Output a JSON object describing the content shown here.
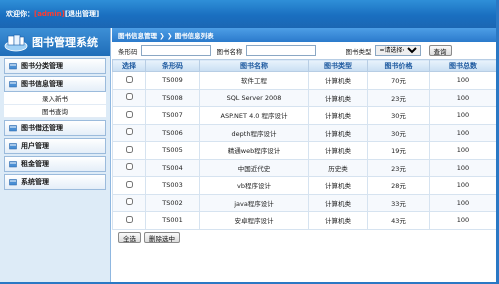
{
  "header": {
    "welcome_prefix": "欢迎你：",
    "user": "[admin]",
    "logout": "[退出管理]"
  },
  "sidebar": {
    "title": "图书管理系统",
    "menu": [
      {
        "label": "图书分类管理",
        "expanded": false,
        "children": []
      },
      {
        "label": "图书信息管理",
        "expanded": true,
        "children": [
          "录入新书",
          "图书查询"
        ]
      },
      {
        "label": "图书借还管理",
        "expanded": false,
        "children": []
      },
      {
        "label": "用户管理",
        "expanded": false,
        "children": []
      },
      {
        "label": "租金管理",
        "expanded": false,
        "children": []
      },
      {
        "label": "系统管理",
        "expanded": false,
        "children": []
      }
    ]
  },
  "main": {
    "breadcrumb": "图书信息管理 ❯ ❯ 图书信息列表",
    "search": {
      "code_label": "条形码",
      "code_value": "",
      "name_label": "图书名称",
      "name_value": "",
      "type_label": "图书类型",
      "type_selected": "=请选择=",
      "search_button": "查询"
    },
    "table": {
      "headers": [
        "选择",
        "条形码",
        "图书名称",
        "图书类型",
        "图书价格",
        "图书总数"
      ],
      "rows": [
        [
          "",
          "TS009",
          "软件工程",
          "计算机类",
          "70元",
          "100"
        ],
        [
          "",
          "TS008",
          "SQL Server 2008",
          "计算机类",
          "23元",
          "100"
        ],
        [
          "",
          "TS007",
          "ASP.NET 4.0 程序设计",
          "计算机类",
          "30元",
          "100"
        ],
        [
          "",
          "TS006",
          "depth程序设计",
          "计算机类",
          "30元",
          "100"
        ],
        [
          "",
          "TS005",
          "精通web程序设计",
          "计算机类",
          "19元",
          "100"
        ],
        [
          "",
          "TS004",
          "中国近代史",
          "历史类",
          "23元",
          "100"
        ],
        [
          "",
          "TS003",
          "vb程序设计",
          "计算机类",
          "28元",
          "100"
        ],
        [
          "",
          "TS002",
          "java程序设计",
          "计算机类",
          "33元",
          "100"
        ],
        [
          "",
          "TS001",
          "安卓程序设计",
          "计算机类",
          "43元",
          "100"
        ]
      ]
    },
    "actions": {
      "select_all": "全选",
      "delete_selected": "删除选中"
    }
  },
  "colors": {
    "header_blue": "#1a6fc0",
    "sidebar_bg": "#ddebf7",
    "table_header_text": "#1e5aa0",
    "username_red": "#ff3b2f"
  }
}
